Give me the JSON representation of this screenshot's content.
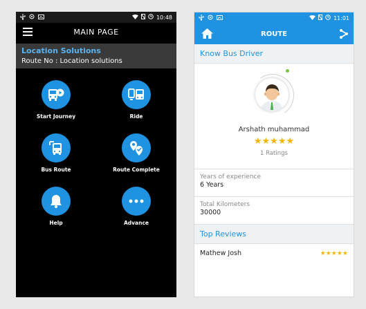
{
  "left": {
    "status": {
      "time": "10:48"
    },
    "header": {
      "title": "MAIN PAGE"
    },
    "org": {
      "name": "Location Solutions",
      "route": "Route No : Location solutions"
    },
    "tiles": [
      {
        "label": "Start Journey",
        "icon": "bus-play-icon"
      },
      {
        "label": "Ride",
        "icon": "bus-ride-icon"
      },
      {
        "label": "Bus Route",
        "icon": "bus-route-icon"
      },
      {
        "label": "Route Complete",
        "icon": "map-pin-check-icon"
      },
      {
        "label": "Help",
        "icon": "bell-icon"
      },
      {
        "label": "Advance",
        "icon": "more-icon"
      }
    ]
  },
  "right": {
    "status": {
      "time": "11:01"
    },
    "header": {
      "title": "ROUTE"
    },
    "section": "Know Bus Driver",
    "driver": {
      "name": "Arshath muhammad",
      "rating_stars": 5,
      "ratings_text": "1 Ratings"
    },
    "info": [
      {
        "label": "Years of experience",
        "value": "6 Years"
      },
      {
        "label": "Total Kilometers",
        "value": "30000"
      }
    ],
    "reviews_title": "Top Reviews",
    "reviews": [
      {
        "name": "Mathew Josh",
        "stars": 5
      }
    ]
  },
  "colors": {
    "accent": "#1f93e2",
    "star": "#f2b705",
    "left_bg": "#000000"
  }
}
